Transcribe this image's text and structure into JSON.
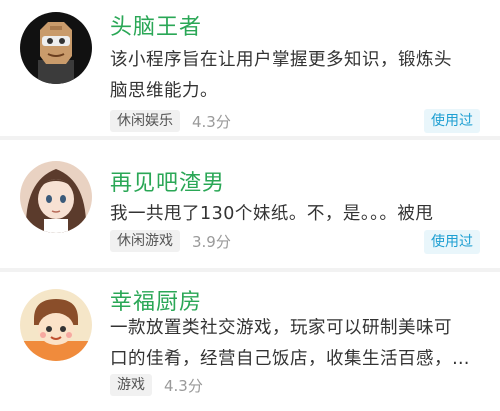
{
  "items": [
    {
      "title": "头脑王者",
      "desc_line1": "该小程序旨在让用户掌握更多知识，锻炼头",
      "desc_line2": "脑思维能力。",
      "tag": "休闲娱乐",
      "score": "4.3分",
      "badge": "使用过"
    },
    {
      "title": "再见吧渣男",
      "desc_line1": "我一共甩了130个妹纸。不，是。。。被甩",
      "tag": "休闲游戏",
      "score": "3.9分",
      "badge": "使用过"
    },
    {
      "title": "幸福厨房",
      "desc_line1": "一款放置类社交游戏，玩家可以研制美味可",
      "desc_line2": "口的佳肴，经营自己饭店，收集生活百感，…",
      "tag": "游戏",
      "score": "4.3分"
    }
  ],
  "colors": {
    "title_green": "#2aa756",
    "badge_blue": "#1e9fd2",
    "badge_bg": "#e9f6fb"
  }
}
